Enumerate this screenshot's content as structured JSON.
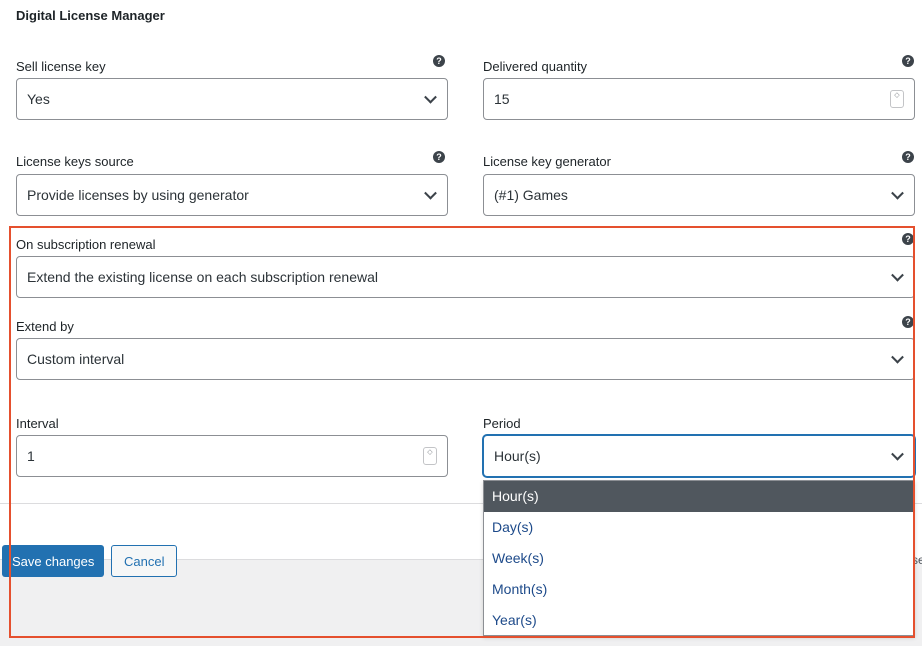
{
  "section_title": "Digital License Manager",
  "fields": {
    "sell_license_key": {
      "label": "Sell license key",
      "value": "Yes"
    },
    "delivered_quantity": {
      "label": "Delivered quantity",
      "value": "15"
    },
    "license_keys_source": {
      "label": "License keys source",
      "value": "Provide licenses by using generator"
    },
    "license_key_generator": {
      "label": "License key generator",
      "value": "(#1) Games"
    },
    "subscription_renewal": {
      "label": "On subscription renewal",
      "value": "Extend the existing license on each subscription renewal"
    },
    "extend_by": {
      "label": "Extend by",
      "value": "Custom interval"
    },
    "interval": {
      "label": "Interval",
      "value": "1"
    },
    "period": {
      "label": "Period",
      "value": "Hour(s)"
    }
  },
  "period_options": [
    "Hour(s)",
    "Day(s)",
    "Week(s)",
    "Month(s)",
    "Year(s)"
  ],
  "buttons": {
    "save": "Save changes",
    "cancel": "Cancel"
  },
  "cut_text": "se",
  "help_glyph": "?",
  "spin_glyph": "◇",
  "icons": {
    "help": "question-circle-icon",
    "chevron": "chevron-down-icon",
    "spinner": "number-spinner-icon"
  },
  "colors": {
    "accent": "#2271b1",
    "highlight": "#e5502e",
    "selected_option": "#50575e"
  }
}
